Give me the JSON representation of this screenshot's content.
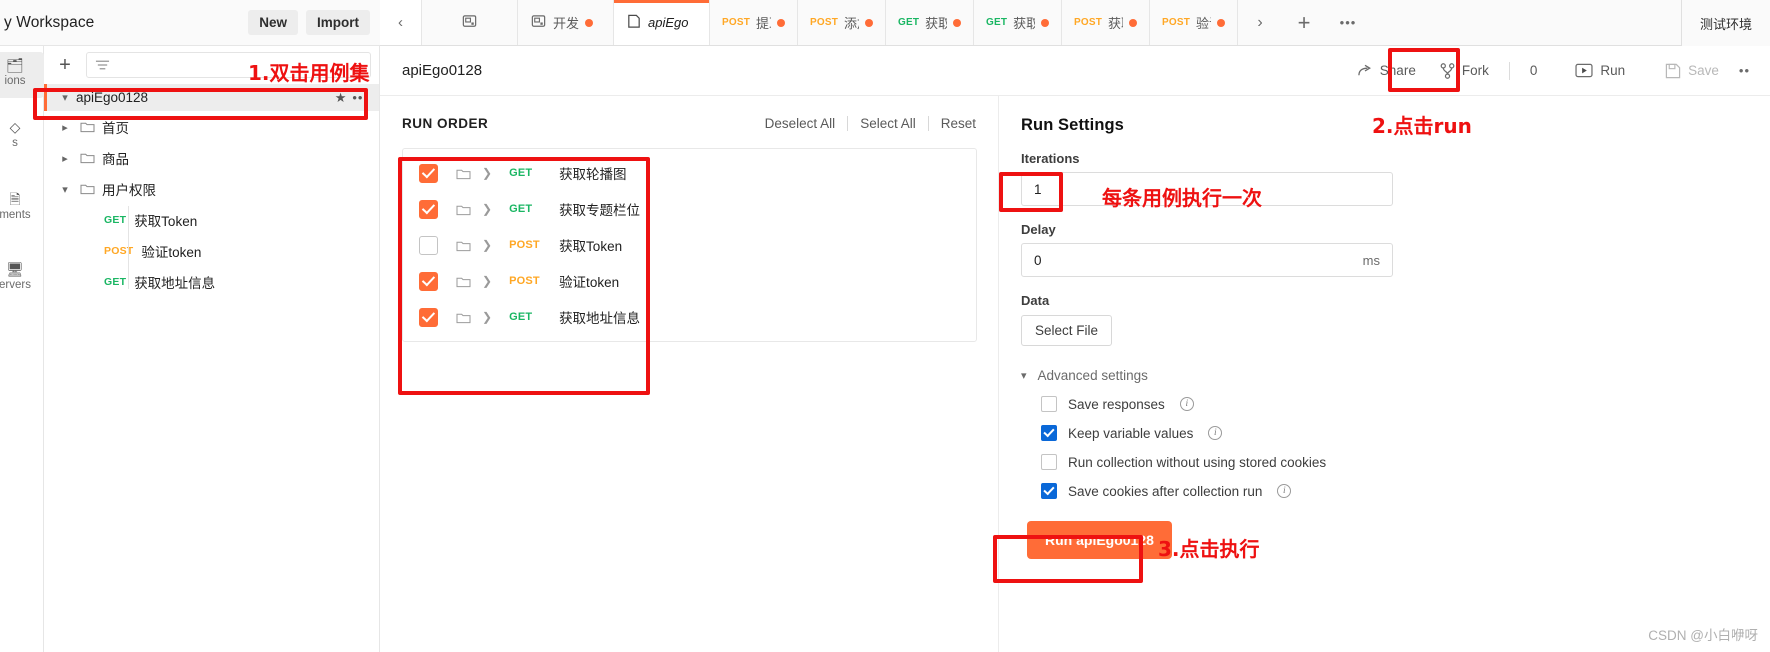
{
  "workspace": {
    "title": "y Workspace",
    "new_label": "New",
    "import_label": "Import"
  },
  "leftnav": {
    "items": [
      {
        "label": "ions",
        "icon": "collections-icon",
        "active": true
      },
      {
        "label": "s",
        "icon": "apis-icon",
        "active": false
      },
      {
        "label": "ments",
        "icon": "environments-icon",
        "active": false
      },
      {
        "label": "ervers",
        "icon": "mock-servers-icon",
        "active": false
      }
    ]
  },
  "tree": {
    "filter_placeholder": "",
    "root": {
      "label": "apiEgo0128",
      "expanded": true
    },
    "nodes": [
      {
        "type": "folder",
        "label": "首页",
        "expanded": false
      },
      {
        "type": "folder",
        "label": "商品",
        "expanded": false
      },
      {
        "type": "folder",
        "label": "用户权限",
        "expanded": true
      },
      {
        "type": "request",
        "method": "GET",
        "label": "获取Token"
      },
      {
        "type": "request",
        "method": "POST",
        "label": "验证token"
      },
      {
        "type": "request",
        "method": "GET",
        "label": "获取地址信息"
      }
    ]
  },
  "tabbar": {
    "tabs": [
      {
        "kind": "icon",
        "label": "",
        "dirty": false,
        "active": false
      },
      {
        "kind": "icon",
        "label": "开发",
        "dirty": true,
        "active": false
      },
      {
        "kind": "collection",
        "label": "apiEgo",
        "dirty": false,
        "active": true
      },
      {
        "kind": "request",
        "method": "POST",
        "label": "提耳",
        "dirty": true,
        "active": false
      },
      {
        "kind": "request",
        "method": "POST",
        "label": "添加",
        "dirty": true,
        "active": false
      },
      {
        "kind": "request",
        "method": "GET",
        "label": "获取",
        "dirty": true,
        "active": false
      },
      {
        "kind": "request",
        "method": "GET",
        "label": "获取",
        "dirty": true,
        "active": false
      },
      {
        "kind": "request",
        "method": "POST",
        "label": "获取",
        "dirty": true,
        "active": false
      },
      {
        "kind": "request",
        "method": "POST",
        "label": "验证",
        "dirty": true,
        "active": false
      }
    ],
    "environment": "测试环境"
  },
  "main_header": {
    "title": "apiEgo0128",
    "share_label": "Share",
    "fork_label": "Fork",
    "fork_count": "0",
    "run_label": "Run",
    "save_label": "Save"
  },
  "run_order": {
    "title": "RUN ORDER",
    "deselect_all": "Deselect All",
    "select_all": "Select All",
    "reset": "Reset",
    "items": [
      {
        "checked": true,
        "method": "GET",
        "name": "获取轮播图"
      },
      {
        "checked": true,
        "method": "GET",
        "name": "获取专题栏位"
      },
      {
        "checked": false,
        "method": "POST",
        "name": "获取Token"
      },
      {
        "checked": true,
        "method": "POST",
        "name": "验证token"
      },
      {
        "checked": true,
        "method": "GET",
        "name": "获取地址信息"
      }
    ]
  },
  "run_settings": {
    "title": "Run Settings",
    "iterations_label": "Iterations",
    "iterations_value": "1",
    "delay_label": "Delay",
    "delay_value": "0",
    "delay_unit": "ms",
    "data_label": "Data",
    "select_file_label": "Select File",
    "advanced_label": "Advanced settings",
    "options": [
      {
        "label": "Save responses",
        "checked": false,
        "info": true
      },
      {
        "label": "Keep variable values",
        "checked": true,
        "info": true
      },
      {
        "label": "Run collection without using stored cookies",
        "checked": false,
        "info": false
      },
      {
        "label": "Save cookies after collection run",
        "checked": true,
        "info": true
      }
    ],
    "run_button_label": "Run apiEgo0128"
  },
  "annotations": {
    "step1": "1.双击用例集",
    "step2": "2.点击run",
    "iterations_note": "每条用例执行一次",
    "step3": "3.点击执行"
  },
  "watermark": "CSDN @小白咿呀",
  "colors": {
    "accent": "#ff6c37",
    "annotation": "#ee1111",
    "get": "#1ab663",
    "post": "#ffa724",
    "checkbox_blue": "#0a68d8"
  }
}
